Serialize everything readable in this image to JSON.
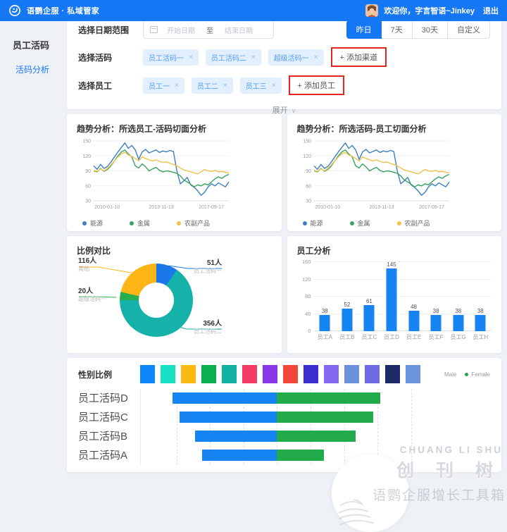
{
  "header": {
    "brand": "语鹦企服 · 私域管家",
    "welcome": "欢迎你，字言智语~Jinkey",
    "logout": "退出"
  },
  "sidebar": {
    "title": "员工活码",
    "items": [
      {
        "label": "活码分析",
        "active": true
      }
    ]
  },
  "filters": {
    "date_label": "选择日期范围",
    "date_start_placeholder": "开始日期",
    "date_separator": "至",
    "date_end_placeholder": "结束日期",
    "range_options": [
      "昨日",
      "7天",
      "30天",
      "自定义"
    ],
    "active_range": "昨日",
    "code_label": "选择活码",
    "code_tags": [
      "员工活码一",
      "员工活码二",
      "超级活码一"
    ],
    "tag_close_icon": "×",
    "add_channel_label": "+ 添加渠道",
    "staff_label": "选择员工",
    "staff_tags": [
      "员工一",
      "员工二",
      "员工三"
    ],
    "add_staff_label": "+ 添加员工",
    "expand_label": "展开",
    "expand_chevron": "∨",
    "highlight_color": "#e0251f"
  },
  "chart_data": [
    {
      "type": "line",
      "title": "趋势分析：所选员工-活码切面分析",
      "x_ticks": [
        "2010-01-10",
        "2013-11-13",
        "2017-09-17"
      ],
      "y_ticks": [
        30,
        60,
        90,
        120,
        150
      ],
      "ylim": [
        30,
        150
      ],
      "grid": true,
      "legend_position": "bottom",
      "series": [
        {
          "name": "能源",
          "color": "#3d7fc4",
          "values": [
            100,
            93,
            103,
            95,
            99,
            108,
            118,
            128,
            137,
            146,
            135,
            141,
            132,
            113,
            128,
            133,
            126,
            129,
            132,
            127,
            130,
            128,
            131,
            129,
            90,
            64,
            70,
            77,
            62,
            57,
            50,
            41,
            47,
            58,
            64,
            60,
            66,
            62,
            58,
            68
          ]
        },
        {
          "name": "金属",
          "color": "#37a35c",
          "values": [
            90,
            88,
            95,
            89,
            93,
            100,
            110,
            120,
            128,
            132,
            124,
            118,
            100,
            96,
            104,
            98,
            90,
            94,
            97,
            91,
            88,
            90,
            89,
            87,
            85,
            80,
            72,
            68,
            63,
            58,
            62,
            60,
            64,
            62,
            68,
            74,
            78,
            75,
            80,
            83
          ]
        },
        {
          "name": "农副产品",
          "color": "#f0c14b",
          "values": [
            91,
            89,
            94,
            90,
            95,
            102,
            110,
            118,
            124,
            127,
            122,
            119,
            115,
            110,
            118,
            115,
            112,
            110,
            112,
            109,
            107,
            108,
            105,
            103,
            100,
            96,
            92,
            90,
            88,
            86,
            84,
            88,
            93,
            90,
            89,
            91,
            88,
            89,
            87,
            86
          ]
        }
      ]
    },
    {
      "type": "line",
      "title": "趋势分析：所选活码-员工切面分析",
      "x_ticks": [
        "2010-01-10",
        "2013-11-13",
        "2017-09-17"
      ],
      "y_ticks": [
        30,
        60,
        90,
        120,
        150
      ],
      "ylim": [
        30,
        150
      ],
      "grid": true,
      "legend_position": "bottom",
      "series": [
        {
          "name": "能源",
          "color": "#3d7fc4",
          "values": [
            100,
            93,
            103,
            95,
            99,
            108,
            118,
            128,
            137,
            146,
            135,
            141,
            132,
            113,
            128,
            133,
            126,
            129,
            132,
            127,
            130,
            128,
            131,
            129,
            90,
            64,
            70,
            77,
            62,
            57,
            50,
            41,
            47,
            58,
            64,
            60,
            66,
            62,
            58,
            68
          ]
        },
        {
          "name": "金属",
          "color": "#37a35c",
          "values": [
            90,
            88,
            95,
            89,
            93,
            100,
            110,
            120,
            128,
            132,
            124,
            118,
            100,
            96,
            104,
            98,
            90,
            94,
            97,
            91,
            88,
            90,
            89,
            87,
            85,
            80,
            72,
            68,
            63,
            58,
            62,
            60,
            64,
            62,
            68,
            74,
            78,
            75,
            80,
            83
          ]
        },
        {
          "name": "农副产品",
          "color": "#f0c14b",
          "values": [
            91,
            89,
            94,
            90,
            95,
            102,
            110,
            118,
            124,
            127,
            122,
            119,
            115,
            110,
            118,
            115,
            112,
            110,
            112,
            109,
            107,
            108,
            105,
            103,
            100,
            96,
            92,
            90,
            88,
            86,
            84,
            88,
            93,
            90,
            89,
            91,
            88,
            89,
            87,
            86
          ]
        }
      ]
    },
    {
      "type": "pie",
      "title": "比例对比",
      "donut": true,
      "unit": "人",
      "slices": [
        {
          "label": "员工活码一",
          "value": 51,
          "display": "51人",
          "color": "#1a78e8"
        },
        {
          "label": "员工活码二",
          "value": 356,
          "display": "356人",
          "color": "#16b1a8"
        },
        {
          "label": "超级活码一",
          "value": 20,
          "display": "20人",
          "color": "#27ae4e"
        },
        {
          "label": "其他",
          "value": 116,
          "display": "116人",
          "color": "#fdb515"
        }
      ]
    },
    {
      "type": "bar",
      "title": "员工分析",
      "categories": [
        "员工A",
        "员工B",
        "员工C",
        "员工D",
        "员工E",
        "员工F",
        "员工G",
        "员工H"
      ],
      "values": [
        38,
        52,
        61,
        145,
        48,
        38,
        38,
        38
      ],
      "y_ticks": [
        0,
        40,
        80,
        120,
        160
      ],
      "ylim": [
        0,
        160
      ],
      "bar_color": "#1583f2"
    },
    {
      "type": "bar-horizontal-diverging",
      "title": "性别比例",
      "categories": [
        "员工活码D",
        "员工活码C",
        "员工活码B",
        "员工活码A"
      ],
      "center_pct": 39,
      "series": [
        {
          "name": "Male",
          "color": "#1583f2",
          "values_pct": [
            30,
            28,
            23.5,
            21.5
          ]
        },
        {
          "name": "Female",
          "color": "#21ab4a",
          "values_pct": [
            29.5,
            27.5,
            22.5,
            13.5
          ]
        }
      ],
      "legend": [
        {
          "name": "Male",
          "color": "#1583f2",
          "dot_visible": false
        },
        {
          "name": "Female",
          "color": "#21ab4a",
          "dot_visible": true
        }
      ],
      "palette_swatches": [
        "#0d86f8",
        "#19e2c4",
        "#fdb913",
        "#0caf4d",
        "#12b2a4",
        "#f23c64",
        "#8a37e8",
        "#f4473c",
        "#3b2ed0",
        "#8669f2",
        "#6b91dc",
        "#6e6ce2",
        "#1d2a68",
        "#6b94de"
      ]
    }
  ],
  "watermark": {
    "brand_en": "CHUANG LI SHU",
    "brand_cn": "创 刊 树",
    "tagline": "语鹦企服增长工具箱"
  }
}
